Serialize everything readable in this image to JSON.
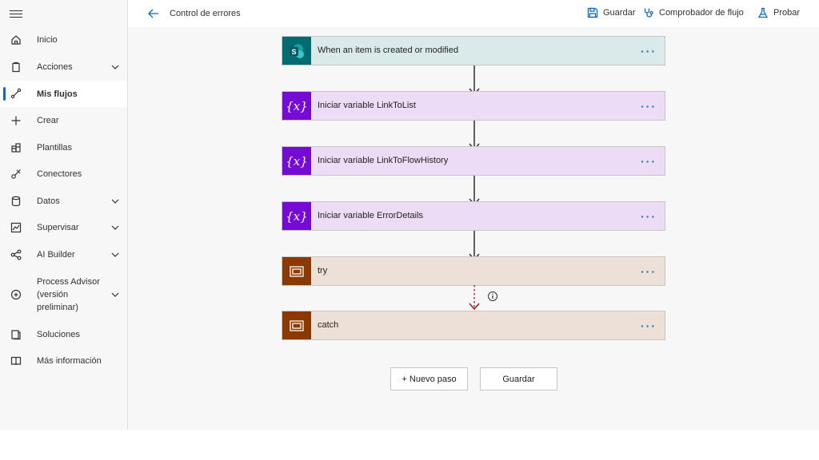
{
  "sidebar": {
    "items": [
      {
        "label": "Inicio",
        "icon": "home-icon"
      },
      {
        "label": "Acciones",
        "icon": "clipboard-icon",
        "expandable": true
      },
      {
        "label": "Mis flujos",
        "icon": "flow-icon",
        "active": true
      },
      {
        "label": "Crear",
        "icon": "plus-icon"
      },
      {
        "label": "Plantillas",
        "icon": "templates-icon"
      },
      {
        "label": "Conectores",
        "icon": "connector-icon"
      },
      {
        "label": "Datos",
        "icon": "database-icon",
        "expandable": true
      },
      {
        "label": "Supervisar",
        "icon": "monitor-icon",
        "expandable": true
      },
      {
        "label": "AI Builder",
        "icon": "ai-builder-icon",
        "expandable": true
      },
      {
        "label": "Process Advisor\n(versión\npreliminar)",
        "icon": "process-advisor-icon",
        "expandable": true
      },
      {
        "label": "Soluciones",
        "icon": "solutions-icon"
      },
      {
        "label": "Más información",
        "icon": "book-icon"
      }
    ]
  },
  "header": {
    "title": "Control de errores",
    "actions": {
      "save": "Guardar",
      "checker": "Comprobador de flujo",
      "test": "Probar"
    }
  },
  "flow": {
    "steps": [
      {
        "title": "When an item is created or modified",
        "kind": "sharepoint",
        "icon": "sharepoint-icon",
        "more": "···"
      },
      {
        "title": "Iniciar variable LinkToList",
        "kind": "variable",
        "icon": "variable-icon",
        "icon_text": "{x}",
        "more": "···"
      },
      {
        "title": "Iniciar variable LinkToFlowHistory",
        "kind": "variable",
        "icon": "variable-icon",
        "icon_text": "{x}",
        "more": "···"
      },
      {
        "title": "Iniciar variable ErrorDetails",
        "kind": "variable",
        "icon": "variable-icon",
        "icon_text": "{x}",
        "more": "···"
      },
      {
        "title": "try",
        "kind": "scope",
        "icon": "scope-icon",
        "more": "···"
      },
      {
        "title": "catch",
        "kind": "scope",
        "icon": "scope-icon",
        "more": "···"
      }
    ],
    "new_step_label": "+ Nuevo paso",
    "save_label": "Guardar"
  },
  "colors": {
    "accent": "#0f6cbd",
    "sharepoint": "#036c70",
    "variable": "#770bd6",
    "scope": "#8c3900",
    "error_arrow": "#a4262c"
  }
}
